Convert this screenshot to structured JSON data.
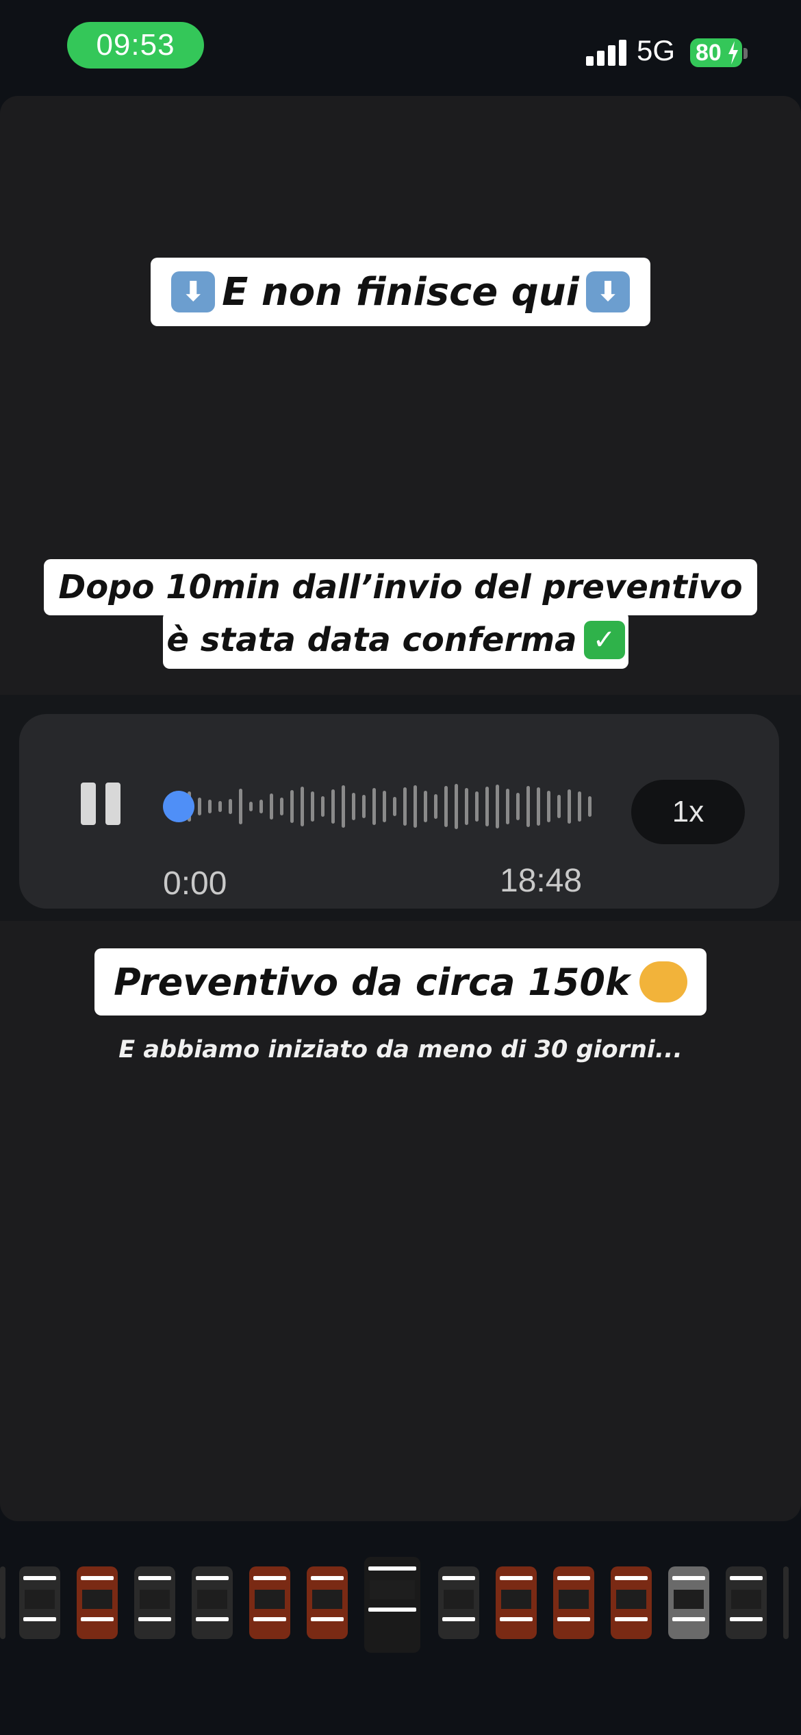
{
  "status": {
    "time": "09:53",
    "network": "5G",
    "battery": "80"
  },
  "story": {
    "caption_top": "E non finisce qui",
    "caption_middle_line1": "Dopo 10min dall’invio del preventivo",
    "caption_middle_line2": "è stata data conferma",
    "caption_quote": "Preventivo da circa 150k",
    "subtitle": "E abbiamo iniziato da meno di 30 giorni..."
  },
  "voice_message": {
    "elapsed": "0:00",
    "duration": "18:48",
    "speed": "1x",
    "progress": 0.0
  },
  "colors": {
    "accent": "#4f8ff7",
    "status_green": "#34c759",
    "story_bg": "#1c1c1e",
    "thumb_orange": "#7a2a14"
  },
  "thumbnails": [
    {
      "name": "thumb-1",
      "color": "#2a2a2a"
    },
    {
      "name": "thumb-2",
      "color": "#7a2a14"
    },
    {
      "name": "thumb-3",
      "color": "#2a2a2a"
    },
    {
      "name": "thumb-4",
      "color": "#2a2a2a"
    },
    {
      "name": "thumb-5",
      "color": "#7a2a14"
    },
    {
      "name": "thumb-6",
      "color": "#7a2a14"
    },
    {
      "name": "thumb-7-active",
      "color": "#1a1a1a"
    },
    {
      "name": "thumb-8",
      "color": "#2a2a2a"
    },
    {
      "name": "thumb-9",
      "color": "#7a2a14"
    },
    {
      "name": "thumb-10",
      "color": "#7a2a14"
    },
    {
      "name": "thumb-11",
      "color": "#7a2a14"
    },
    {
      "name": "thumb-12",
      "color": "#6a6a6a"
    },
    {
      "name": "thumb-13",
      "color": "#2a2a2a"
    }
  ]
}
